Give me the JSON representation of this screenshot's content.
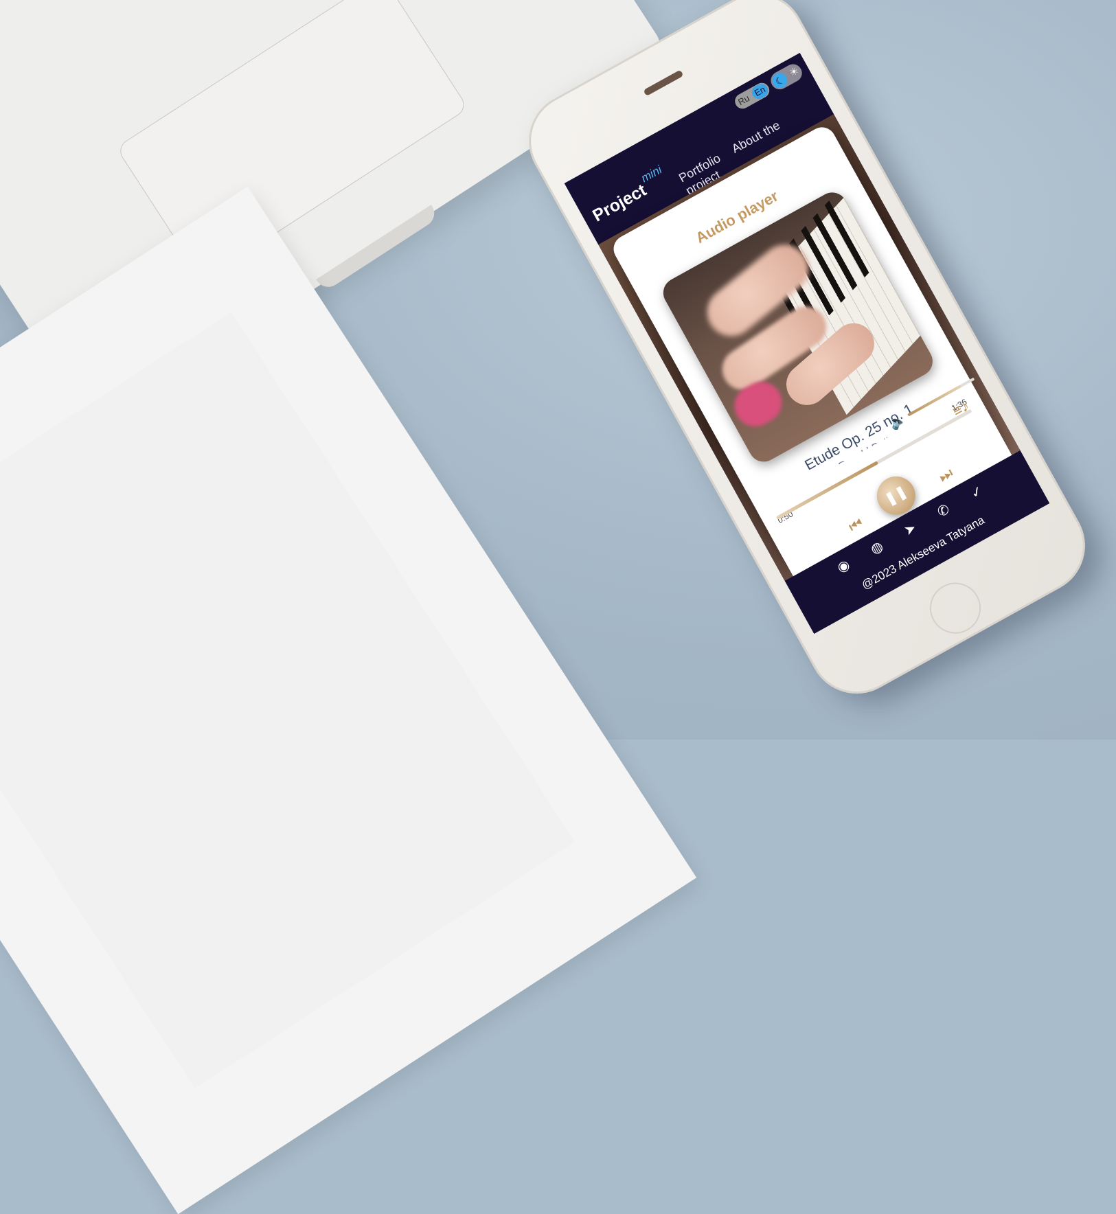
{
  "header": {
    "logo": "Project",
    "logo_badge": "mini",
    "lang_options": [
      "Ru",
      "En"
    ],
    "lang_selected": "En",
    "nav": [
      "Portfolio",
      "About the project"
    ]
  },
  "player": {
    "title": "Audio player",
    "track_title": "Etude Op. 25 no. 1",
    "artist": "Donald Betts",
    "time_current": "0:50",
    "time_total": "1:36",
    "progress_fraction": 0.52,
    "volume_fraction": 0.8
  },
  "footer": {
    "socials": [
      "github-icon",
      "discord-icon",
      "telegram-icon",
      "whatsapp-icon",
      "vk-icon"
    ],
    "copyright": "@2023 Alekseeva Tatyana"
  },
  "colors": {
    "header_bg": "#140f33",
    "accent_gold": "#c49a63",
    "accent_blue": "#3aa3e6"
  }
}
